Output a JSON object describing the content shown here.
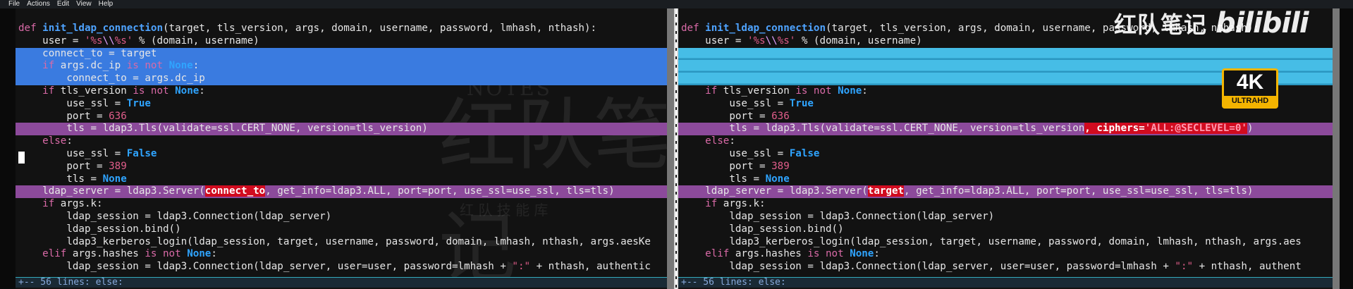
{
  "menu": [
    "File",
    "Actions",
    "Edit",
    "View",
    "Help"
  ],
  "brand": {
    "text": "红队笔记",
    "logo": "bilibili"
  },
  "badge": {
    "big": "4K",
    "small": "ULTRAHD"
  },
  "watermark": {
    "big": "红队笔记",
    "small": "REDTEAM NOTES",
    "tiny": "红 队 技 能 库"
  },
  "fold_text": "+-- 56 lines: else:",
  "left_lines": [
    {
      "hl": "",
      "html": "<span class=\"kw\">def</span> <span class=\"fn\">init_ldap_connection</span>(target, tls_version, args, domain, username, password, lmhash, nthash):"
    },
    {
      "hl": "",
      "html": "    user = <span class=\"str\">'%s</span><span class=\"esc\">\\\\</span><span class=\"str\">%s'</span> % (domain, username)"
    },
    {
      "hl": "hl-blue",
      "html": "    connect_to = target"
    },
    {
      "hl": "hl-blue",
      "html": "    <span class=\"kw\">if</span> args.dc_ip <span class=\"kw\">is not</span> <span class=\"bool\">None</span>:"
    },
    {
      "hl": "hl-blue",
      "html": "        connect_to = args.dc_ip"
    },
    {
      "hl": "",
      "html": "    <span class=\"kw\">if</span> tls_version <span class=\"kw\">is not</span> <span class=\"bool\">None</span>:"
    },
    {
      "hl": "",
      "html": "        use_ssl = <span class=\"bool\">True</span>"
    },
    {
      "hl": "",
      "html": "        port = <span class=\"num\">636</span>"
    },
    {
      "hl": "hl-purple",
      "html": "        tls = ldap3.Tls(validate=ssl.CERT_NONE, version=tls_version)"
    },
    {
      "hl": "",
      "html": "    <span class=\"kw\">else</span>:"
    },
    {
      "hl": "",
      "html": "        use_ssl = <span class=\"bool\">False</span>"
    },
    {
      "hl": "",
      "html": "        port = <span class=\"num\">389</span>"
    },
    {
      "hl": "",
      "html": "        tls = <span class=\"bool\">None</span>"
    },
    {
      "hl": "hl-purple",
      "html": "    ldap_server = ldap3.Server(<span class=\"diff-red\">connect_to</span>, get_info=ldap3.ALL, port=port, use_ssl=use_ssl, tls=tls)"
    },
    {
      "hl": "",
      "html": "    <span class=\"kw\">if</span> args.k:"
    },
    {
      "hl": "",
      "html": "        ldap_session = ldap3.Connection(ldap_server)"
    },
    {
      "hl": "",
      "html": "        ldap_session.bind()"
    },
    {
      "hl": "",
      "html": "        ldap3_kerberos_login(ldap_session, target, username, password, domain, lmhash, nthash, args.aesKe"
    },
    {
      "hl": "",
      "html": "    <span class=\"kw\">elif</span> args.hashes <span class=\"kw\">is not</span> <span class=\"bool\">None</span>:"
    },
    {
      "hl": "",
      "html": "        ldap_session = ldap3.Connection(ldap_server, user=user, password=lmhash + <span class=\"str\">\":\"</span> + nthash, authentic"
    }
  ],
  "right_lines": [
    {
      "hl": "",
      "html": "<span class=\"kw\">def</span> <span class=\"fn\">init_ldap_connection</span>(target, tls_version, args, domain, username, password, lmhash, nthash):"
    },
    {
      "hl": "",
      "html": "    user = <span class=\"str\">'%s</span><span class=\"esc\">\\\\</span><span class=\"str\">%s'</span> % (domain, username)"
    },
    {
      "hl": "hl-cyan",
      "html": ""
    },
    {
      "hl": "hl-cyan",
      "html": ""
    },
    {
      "hl": "hl-cyan",
      "html": ""
    },
    {
      "hl": "",
      "html": "    <span class=\"kw\">if</span> tls_version <span class=\"kw\">is not</span> <span class=\"bool\">None</span>:"
    },
    {
      "hl": "",
      "html": "        use_ssl = <span class=\"bool\">True</span>"
    },
    {
      "hl": "",
      "html": "        port = <span class=\"num\">636</span>"
    },
    {
      "hl": "hl-purple",
      "html": "        tls = ldap3.Tls(validate=ssl.CERT_NONE, version=tls_version<span class=\"diff-red\">, ciphers=<span style=\"color:#ff9ab0\">'ALL:@SECLEVEL=0'</span></span>)"
    },
    {
      "hl": "",
      "html": "    <span class=\"kw\">else</span>:"
    },
    {
      "hl": "",
      "html": "        use_ssl = <span class=\"bool\">False</span>"
    },
    {
      "hl": "",
      "html": "        port = <span class=\"num\">389</span>"
    },
    {
      "hl": "",
      "html": "        tls = <span class=\"bool\">None</span>"
    },
    {
      "hl": "hl-purple",
      "html": "    ldap_server = ldap3.Server(<span class=\"diff-red\">target</span>, get_info=ldap3.ALL, port=port, use_ssl=use_ssl, tls=tls)"
    },
    {
      "hl": "",
      "html": "    <span class=\"kw\">if</span> args.k:"
    },
    {
      "hl": "",
      "html": "        ldap_session = ldap3.Connection(ldap_server)"
    },
    {
      "hl": "",
      "html": "        ldap_session.bind()"
    },
    {
      "hl": "",
      "html": "        ldap3_kerberos_login(ldap_session, target, username, password, domain, lmhash, nthash, args.aes"
    },
    {
      "hl": "",
      "html": "    <span class=\"kw\">elif</span> args.hashes <span class=\"kw\">is not</span> <span class=\"bool\">None</span>:"
    },
    {
      "hl": "",
      "html": "        ldap_session = ldap3.Connection(ldap_server, user=user, password=lmhash + <span class=\"str\">\":\"</span> + nthash, authent"
    }
  ]
}
